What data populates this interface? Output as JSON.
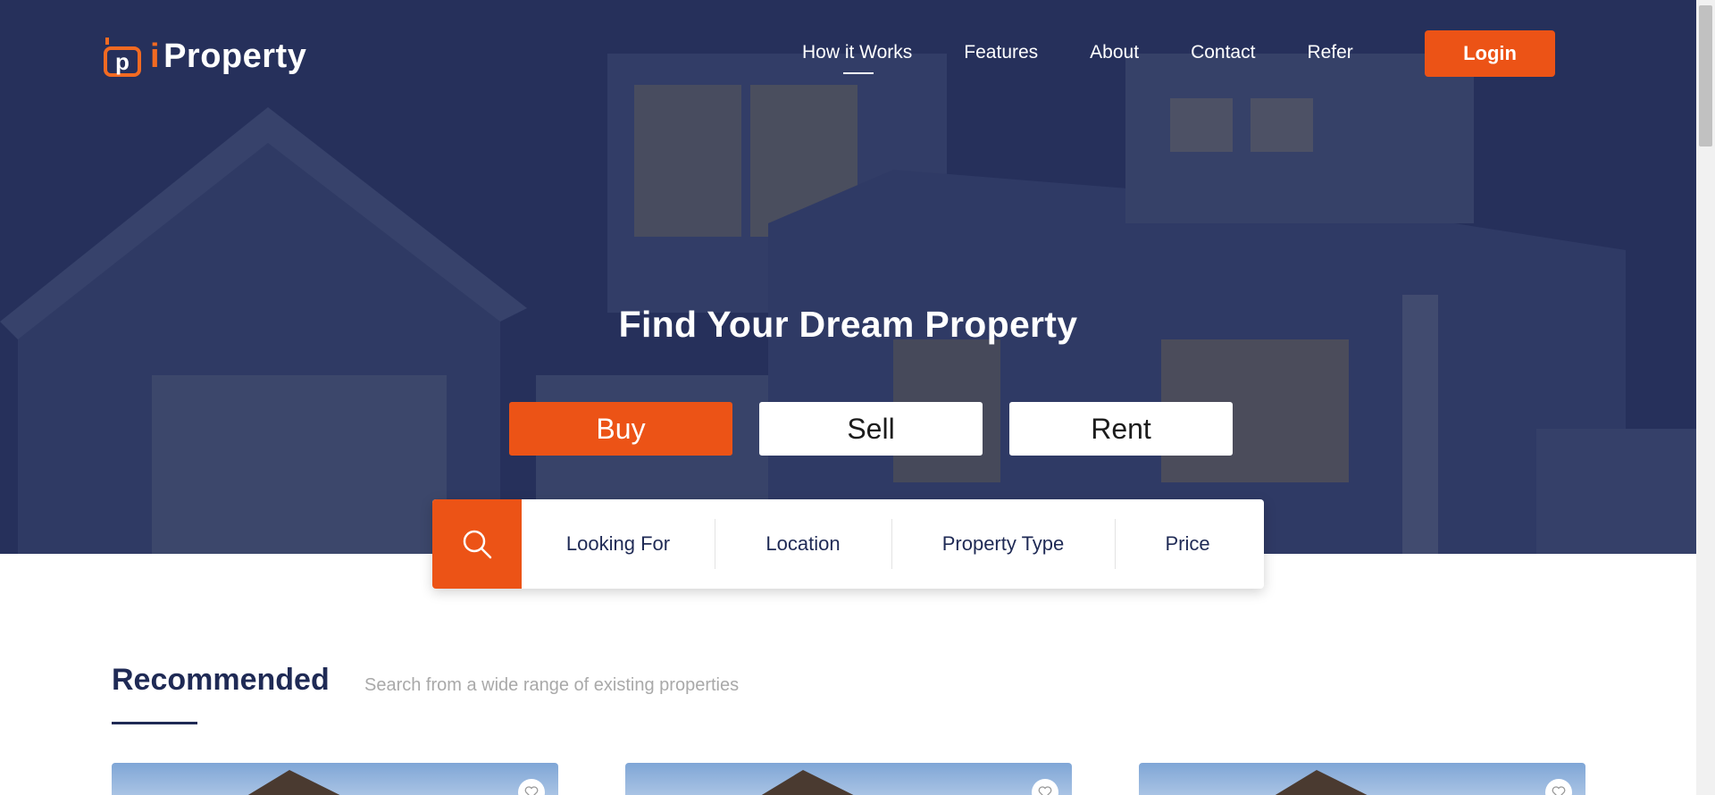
{
  "brand": {
    "mark": "p",
    "prefix": "i",
    "name": "Property",
    "accent": "#ec5316"
  },
  "nav": {
    "items": [
      {
        "label": "How it Works",
        "active": true
      },
      {
        "label": "Features"
      },
      {
        "label": "About"
      },
      {
        "label": "Contact"
      },
      {
        "label": "Refer"
      }
    ],
    "login_label": "Login"
  },
  "hero": {
    "title": "Find Your Dream Property",
    "tabs": [
      {
        "label": "Buy",
        "active": true
      },
      {
        "label": "Sell"
      },
      {
        "label": "Rent"
      }
    ]
  },
  "search": {
    "icon": "search-icon",
    "fields": [
      "Looking For",
      "Location",
      "Property Type",
      "Price"
    ]
  },
  "recommended": {
    "title": "Recommended",
    "subtitle": "Search from a wide range of existing properties"
  },
  "colors": {
    "navy": "#1f2a55",
    "orange": "#ec5316"
  }
}
